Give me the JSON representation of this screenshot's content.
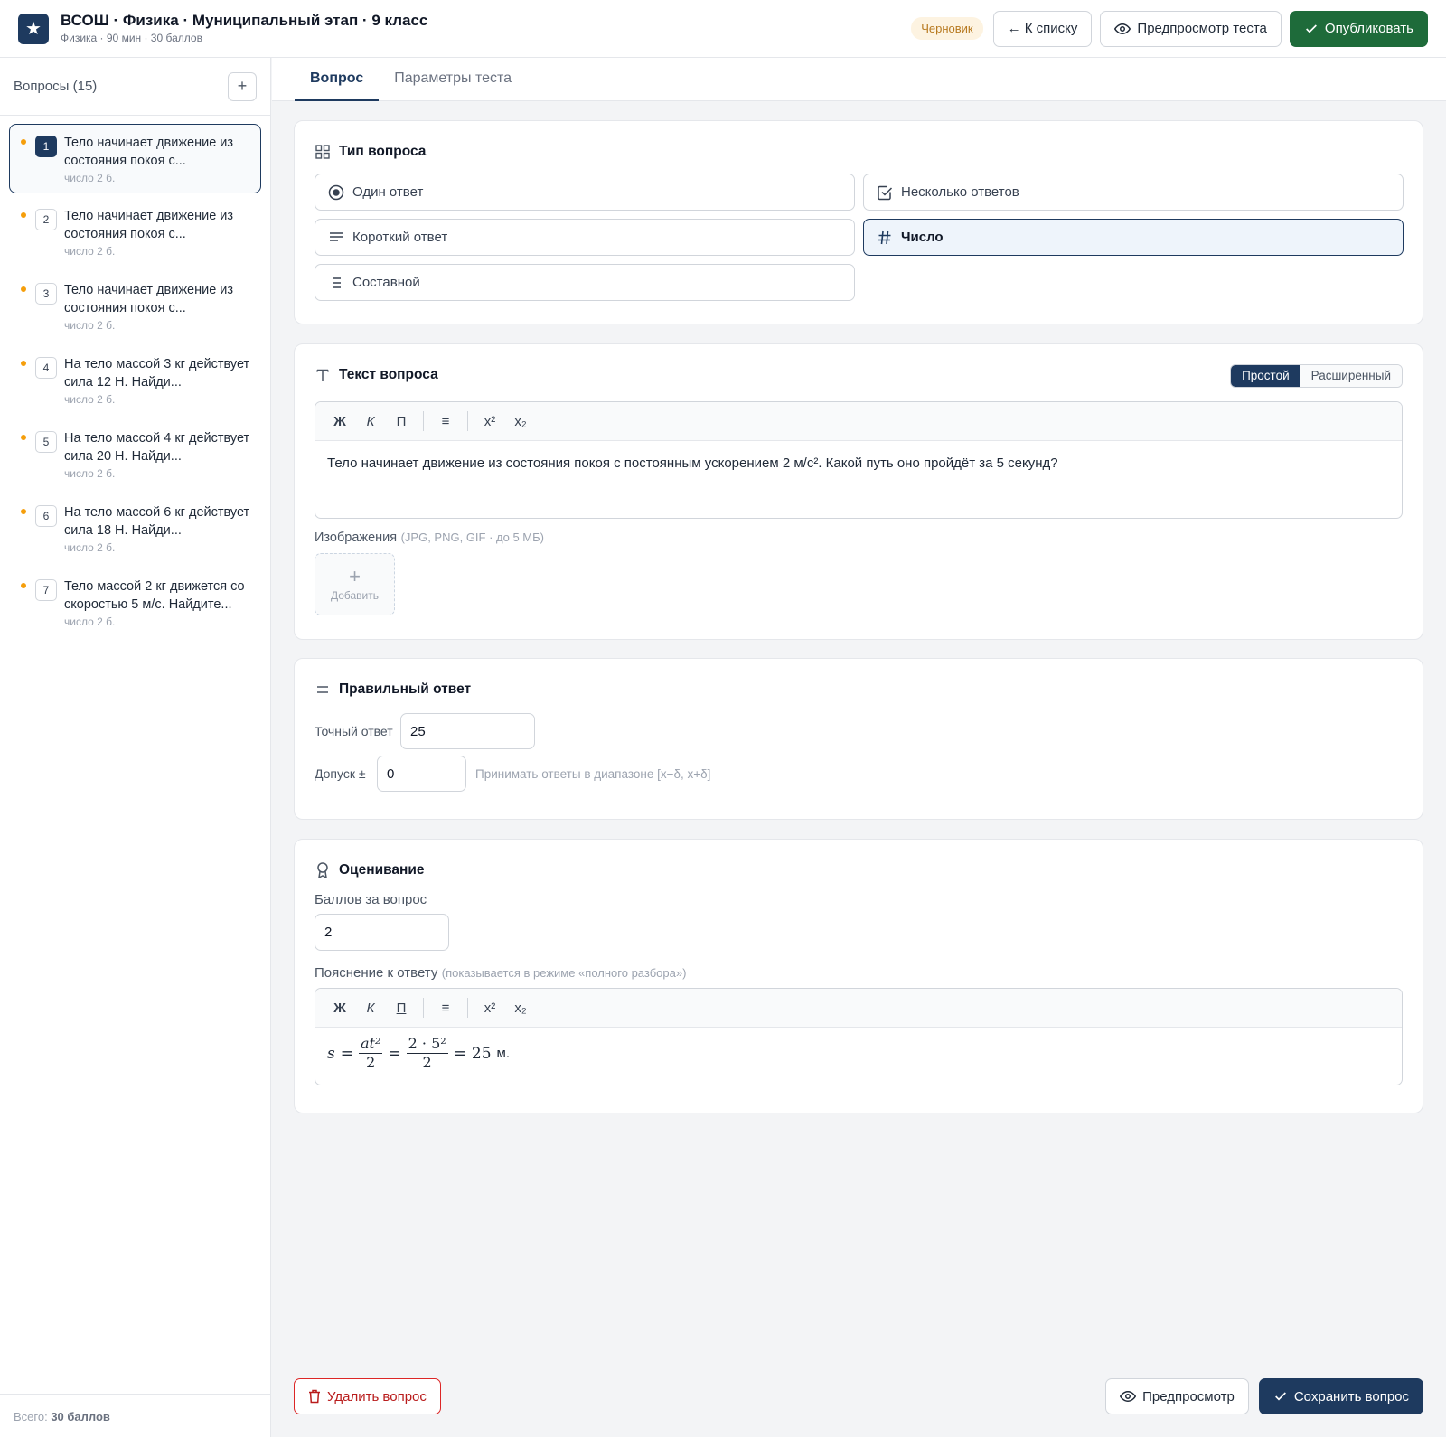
{
  "header": {
    "title": "ВСОШ · Физика · Муниципальный этап · 9 класс",
    "subtitle": "Физика · 90 мин · 30 баллов",
    "status_badge": "Черновик",
    "back_label": "← К списку",
    "preview_label": "Предпросмотр теста",
    "publish_label": "Опубликовать",
    "accent_color": "#1e3a5f",
    "publish_color": "#1e6b3a"
  },
  "sidebar": {
    "title": "Вопросы (15)",
    "add_label": "+",
    "items": [
      {
        "num": "1",
        "text": "Тело начинает движение из состояния покоя с...",
        "meta": "число  2 б."
      },
      {
        "num": "2",
        "text": "Тело начинает движение из состояния покоя с...",
        "meta": "число  2 б."
      },
      {
        "num": "3",
        "text": "Тело начинает движение из состояния покоя с...",
        "meta": "число  2 б."
      },
      {
        "num": "4",
        "text": "На тело массой 3 кг действует сила 12 Н. Найди...",
        "meta": "число  2 б."
      },
      {
        "num": "5",
        "text": "На тело массой 4 кг действует сила 20 Н. Найди...",
        "meta": "число  2 б."
      },
      {
        "num": "6",
        "text": "На тело массой 6 кг действует сила 18 Н. Найди...",
        "meta": "число  2 б."
      },
      {
        "num": "7",
        "text": "Тело массой 2 кг движется со скоростью 5 м/с. Найдите...",
        "meta": "число  2 б."
      }
    ],
    "footer_prefix": "Всего: ",
    "footer_value": "30 баллов"
  },
  "tabs": [
    {
      "label": "Вопрос",
      "active": true
    },
    {
      "label": "Параметры теста",
      "active": false
    }
  ],
  "question_type": {
    "title": "Тип вопроса",
    "options": [
      {
        "label": "Один ответ",
        "icon": "radio-icon"
      },
      {
        "label": "Несколько ответов",
        "icon": "checkbox-icon"
      },
      {
        "label": "Короткий ответ",
        "icon": "text-lines-icon"
      },
      {
        "label": "Число",
        "icon": "hash-icon",
        "selected": true
      },
      {
        "label": "Составной",
        "icon": "list-icon"
      }
    ]
  },
  "question_text": {
    "title": "Текст вопроса",
    "mode_simple": "Простой",
    "mode_advanced": "Расширенный",
    "toolbar": {
      "bold": "Ж",
      "italic": "К",
      "underline": "П",
      "list": "≡",
      "sup": "x²",
      "sub": "x₂"
    },
    "body": "Тело начинает движение из состояния покоя с постоянным ускорением 2 м/с². Какой путь оно пройдёт за 5 секунд?",
    "images_label": "Изображения",
    "images_hint": "(JPG, PNG, GIF · до 5 МБ)",
    "add_image_label": "Добавить"
  },
  "correct_answer": {
    "title": "Правильный ответ",
    "exact_label": "Точный ответ",
    "exact_value": "25",
    "tolerance_label": "Допуск ±",
    "tolerance_value": "0",
    "tolerance_hint": "Принимать ответы в диапазоне [x−δ, x+δ]"
  },
  "grading": {
    "title": "Оценивание",
    "points_label": "Баллов за вопрос",
    "points_value": "2",
    "explanation_label": "Пояснение к ответу",
    "explanation_hint": "(показывается в режиме «полного разбора»)",
    "formula": {
      "lhs": "s",
      "eq": "=",
      "num1": "at²",
      "den1": "2",
      "num2": "2 · 5²",
      "den2": "2",
      "result": "25",
      "unit": "м."
    }
  },
  "footer": {
    "delete_label": "Удалить вопрос",
    "preview_label": "Предпросмотр",
    "save_label": "Сохранить вопрос"
  }
}
